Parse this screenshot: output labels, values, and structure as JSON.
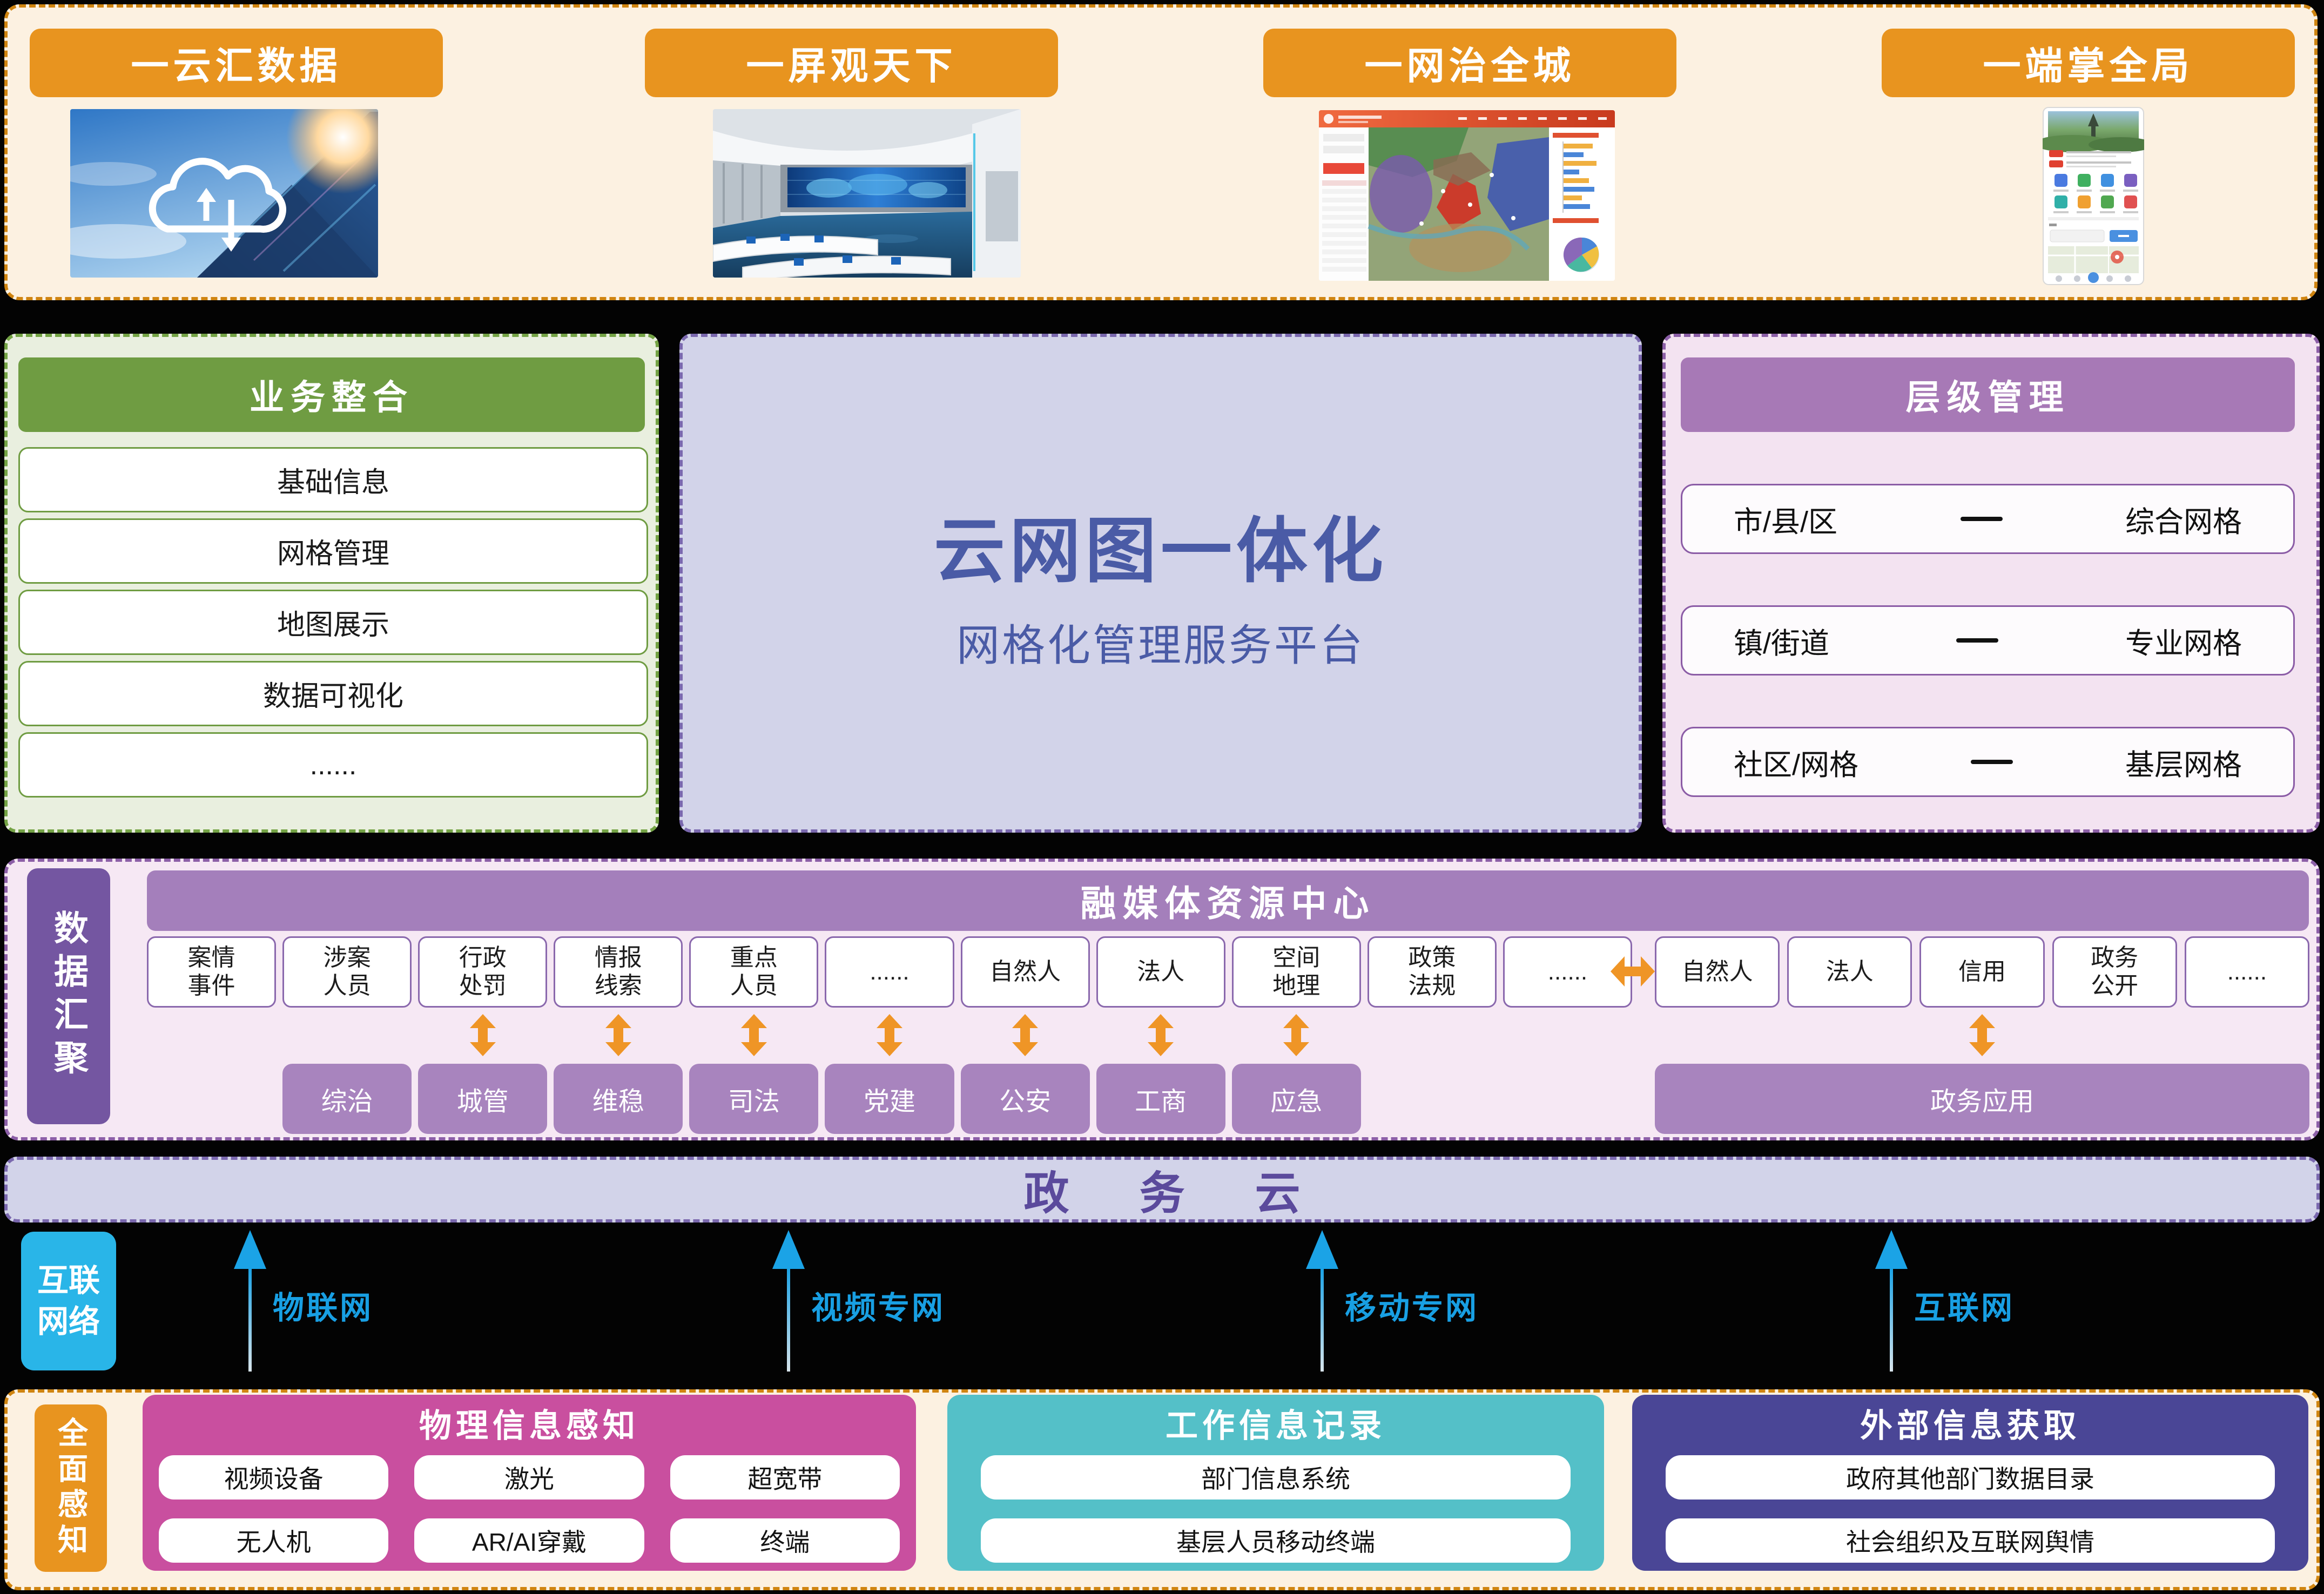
{
  "top_section": {
    "banners": [
      {
        "label": "一云汇数据"
      },
      {
        "label": "一屏观天下"
      },
      {
        "label": "一网治全城"
      },
      {
        "label": "一端掌全局"
      }
    ]
  },
  "business_panel": {
    "title": "业务整合",
    "items": [
      "基础信息",
      "网格管理",
      "地图展示",
      "数据可视化",
      "......"
    ]
  },
  "platform_panel": {
    "title": "云网图一体化",
    "subtitle": "网格化管理服务平台"
  },
  "hierarchy_panel": {
    "title": "层级管理",
    "rows": [
      {
        "left": "市/县/区",
        "right": "综合网格"
      },
      {
        "left": "镇/街道",
        "right": "专业网格"
      },
      {
        "left": "社区/网格",
        "right": "基层网格"
      }
    ]
  },
  "data_hub": {
    "tab": "数据汇聚",
    "header": "融媒体资源中心",
    "left_resources": [
      "案情\n事件",
      "涉案\n人员",
      "行政\n处罚",
      "情报\n线索",
      "重点\n人员",
      "......",
      "自然人",
      "法人",
      "空间\n地理",
      "政策\n法规",
      "......"
    ],
    "left_departments": [
      "综治",
      "城管",
      "维稳",
      "司法",
      "党建",
      "公安",
      "工商",
      "应急"
    ],
    "right_resources": [
      "自然人",
      "法人",
      "信用",
      "政务\n公开",
      "......"
    ],
    "right_department": "政务应用"
  },
  "cloud_bar": {
    "label": "政务云"
  },
  "network_band": {
    "tab": "互联\n网络",
    "channels": [
      "物联网",
      "视频专网",
      "移动专网",
      "互联网"
    ]
  },
  "sensing_band": {
    "tab": "全面感知",
    "physical": {
      "title": "物理信息感知",
      "items": [
        "视频设备",
        "激光",
        "超宽带",
        "无人机",
        "AR/AI穿戴",
        "终端"
      ]
    },
    "work": {
      "title": "工作信息记录",
      "items": [
        "部门信息系统",
        "基层人员移动终端"
      ]
    },
    "external": {
      "title": "外部信息获取",
      "items": [
        "政府其他部门数据目录",
        "社会组织及互联网舆情"
      ]
    }
  },
  "colors": {
    "accent_orange": "#e8941f",
    "border_orange": "#cf8410",
    "green": "#6f9c42",
    "lavender": "#d2d3e9",
    "indigo_text": "#4a5ba6",
    "purple_header": "#a779b6",
    "hub_tab_purple": "#7456a1",
    "hub_header_mauve": "#a47fbb",
    "hub_box_mauve": "#a884be",
    "arrow_orange": "#ef9526",
    "network_cyan": "#29b5e8",
    "network_label_blue": "#189fe3",
    "sensing_magenta": "#c94f9f",
    "sensing_teal": "#54c0c8",
    "sensing_indigo": "#4a4696"
  }
}
